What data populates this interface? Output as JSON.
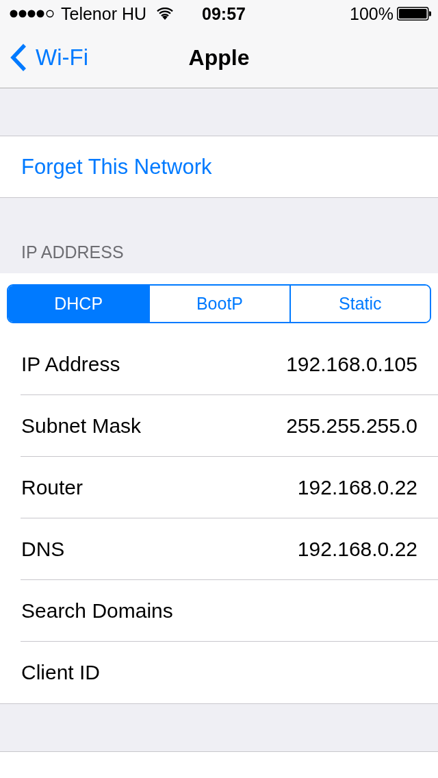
{
  "status_bar": {
    "carrier": "Telenor HU",
    "time": "09:57",
    "battery": "100%"
  },
  "nav_bar": {
    "back": "Wi-Fi",
    "title": "Apple"
  },
  "forget_network": "Forget This Network",
  "ip_address": {
    "header": "IP ADDRESS",
    "modes": [
      {
        "label": "DHCP",
        "selected": true
      },
      {
        "label": "BootP",
        "selected": false
      },
      {
        "label": "Static",
        "selected": false
      }
    ],
    "rows": [
      {
        "label": "IP Address",
        "value": "192.168.0.105"
      },
      {
        "label": "Subnet Mask",
        "value": "255.255.255.0"
      },
      {
        "label": "Router",
        "value": "192.168.0.22"
      },
      {
        "label": "DNS",
        "value": "192.168.0.22"
      },
      {
        "label": "Search Domains"
      },
      {
        "label": "Client ID"
      }
    ]
  }
}
